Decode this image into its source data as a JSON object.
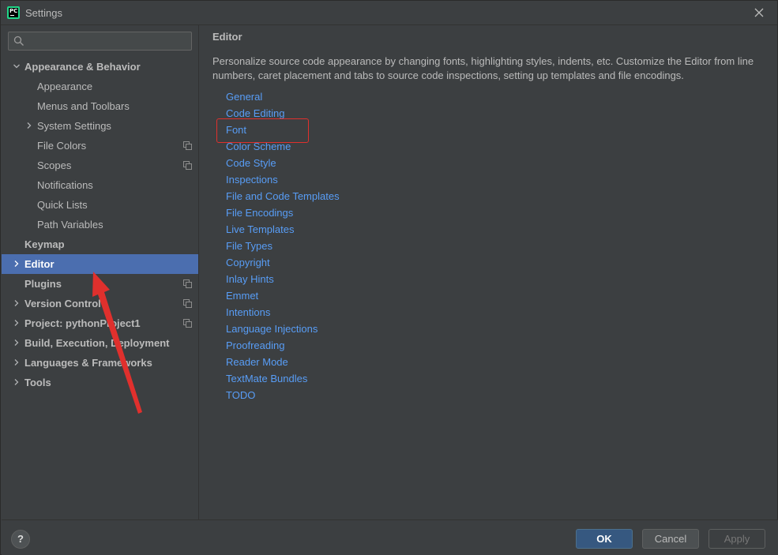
{
  "window": {
    "title": "Settings",
    "app_icon_text": "PC"
  },
  "sidebar": {
    "search": {
      "placeholder": "",
      "value": ""
    },
    "items": [
      {
        "label": "Appearance & Behavior",
        "expanded": true
      },
      {
        "label": "Appearance"
      },
      {
        "label": "Menus and Toolbars"
      },
      {
        "label": "System Settings",
        "collapsed": true
      },
      {
        "label": "File Colors",
        "icon": "copy-icon"
      },
      {
        "label": "Scopes",
        "icon": "copy-icon"
      },
      {
        "label": "Notifications"
      },
      {
        "label": "Quick Lists"
      },
      {
        "label": "Path Variables"
      },
      {
        "label": "Keymap"
      },
      {
        "label": "Editor",
        "selected": true,
        "collapsed": true
      },
      {
        "label": "Plugins",
        "icon": "copy-icon"
      },
      {
        "label": "Version Control",
        "icon": "copy-icon",
        "collapsed": true
      },
      {
        "label": "Project: pythonProject1",
        "icon": "copy-icon",
        "collapsed": true
      },
      {
        "label": "Build, Execution, Deployment",
        "collapsed": true
      },
      {
        "label": "Languages & Frameworks",
        "collapsed": true
      },
      {
        "label": "Tools",
        "collapsed": true
      }
    ]
  },
  "main": {
    "title": "Editor",
    "description": "Personalize source code appearance by changing fonts, highlighting styles, indents, etc. Customize the Editor from line numbers, caret placement and tabs to source code inspections, setting up templates and file encodings.",
    "links": [
      "General",
      "Code Editing",
      "Font",
      "Color Scheme",
      "Code Style",
      "Inspections",
      "File and Code Templates",
      "File Encodings",
      "Live Templates",
      "File Types",
      "Copyright",
      "Inlay Hints",
      "Emmet",
      "Intentions",
      "Language Injections",
      "Proofreading",
      "Reader Mode",
      "TextMate Bundles",
      "TODO"
    ],
    "highlighted_link": "Font"
  },
  "footer": {
    "help_label": "?",
    "ok_label": "OK",
    "cancel_label": "Cancel",
    "apply_label": "Apply"
  },
  "colors": {
    "background": "#3c3f41",
    "selection": "#4b6eaf",
    "link": "#589df6",
    "annotation": "#e0302d",
    "ok_button": "#365880"
  }
}
